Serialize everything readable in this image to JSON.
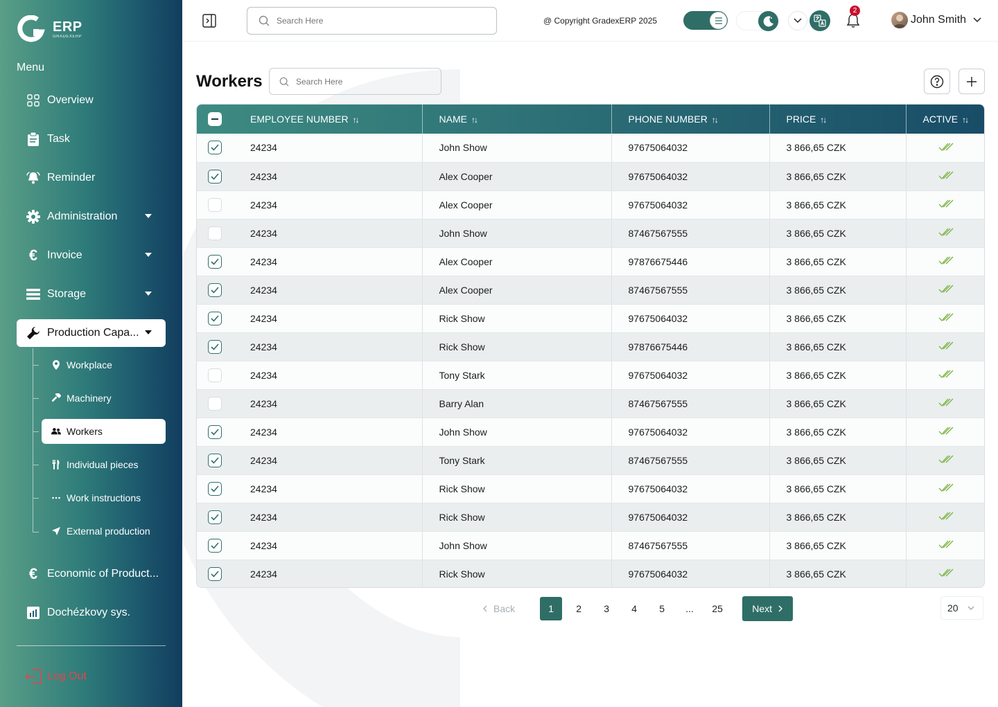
{
  "brand": {
    "name": "ERP",
    "sub": "GRADEXERP"
  },
  "sidebar": {
    "menu_title": "Menu",
    "items": [
      {
        "label": "Overview",
        "icon": "grid-icon"
      },
      {
        "label": "Task",
        "icon": "clipboard-icon"
      },
      {
        "label": "Reminder",
        "icon": "bell-ring-icon"
      },
      {
        "label": "Administration",
        "icon": "gear-icon"
      },
      {
        "label": "Invoice",
        "icon": "euro-icon"
      },
      {
        "label": "Storage",
        "icon": "list-icon"
      },
      {
        "label": "Production Capa...",
        "icon": "wrench-icon"
      },
      {
        "label": "Economic of Product...",
        "icon": "euro-icon"
      },
      {
        "label": "Dochézkovy sys.",
        "icon": "bar-chart-icon"
      }
    ],
    "sub_items": [
      {
        "label": "Workplace",
        "icon": "pin-icon"
      },
      {
        "label": "Machinery",
        "icon": "hammer-icon"
      },
      {
        "label": "Workers",
        "icon": "users-icon"
      },
      {
        "label": "Individual pieces",
        "icon": "tools-icon"
      },
      {
        "label": "Work instructions",
        "icon": "dots-icon"
      },
      {
        "label": "External production",
        "icon": "send-icon"
      }
    ],
    "logout": "Log Out"
  },
  "topbar": {
    "search_placeholder": "Search Here",
    "copyright": "@ Copyright GradexERP 2025",
    "notification_count": "2",
    "user_name": "John Smith"
  },
  "page": {
    "title": "Workers",
    "search_placeholder": "Search Here"
  },
  "table": {
    "columns": [
      "EMPLOYEE NUMBER",
      "NAME",
      "PHONE NUMBER",
      "PRICE",
      "ACTIVE"
    ],
    "rows": [
      {
        "checked": true,
        "emp": "24234",
        "name": "John Show",
        "phone": "97675064032",
        "price": "3 866,65 CZK"
      },
      {
        "checked": true,
        "emp": "24234",
        "name": "Alex Cooper",
        "phone": "97675064032",
        "price": "3 866,65 CZK"
      },
      {
        "checked": false,
        "emp": "24234",
        "name": "Alex Cooper",
        "phone": "97675064032",
        "price": "3 866,65 CZK"
      },
      {
        "checked": false,
        "emp": "24234",
        "name": "John Show",
        "phone": "87467567555",
        "price": "3 866,65 CZK"
      },
      {
        "checked": true,
        "emp": "24234",
        "name": "Alex Cooper",
        "phone": "97876675446",
        "price": "3 866,65 CZK"
      },
      {
        "checked": true,
        "emp": "24234",
        "name": "Alex Cooper",
        "phone": "87467567555",
        "price": "3 866,65 CZK"
      },
      {
        "checked": true,
        "emp": "24234",
        "name": "Rick Show",
        "phone": "97675064032",
        "price": "3 866,65 CZK"
      },
      {
        "checked": true,
        "emp": "24234",
        "name": "Rick Show",
        "phone": "97876675446",
        "price": "3 866,65 CZK"
      },
      {
        "checked": false,
        "emp": "24234",
        "name": "Tony Stark",
        "phone": "97675064032",
        "price": "3 866,65 CZK"
      },
      {
        "checked": false,
        "emp": "24234",
        "name": "Barry Alan",
        "phone": "87467567555",
        "price": "3 866,65 CZK"
      },
      {
        "checked": true,
        "emp": "24234",
        "name": "John Show",
        "phone": "97675064032",
        "price": "3 866,65 CZK"
      },
      {
        "checked": true,
        "emp": "24234",
        "name": "Tony Stark",
        "phone": "87467567555",
        "price": "3 866,65 CZK"
      },
      {
        "checked": true,
        "emp": "24234",
        "name": "Rick Show",
        "phone": "97675064032",
        "price": "3 866,65 CZK"
      },
      {
        "checked": true,
        "emp": "24234",
        "name": "Rick Show",
        "phone": "97675064032",
        "price": "3 866,65 CZK"
      },
      {
        "checked": true,
        "emp": "24234",
        "name": "John Show",
        "phone": "87467567555",
        "price": "3 866,65 CZK"
      },
      {
        "checked": true,
        "emp": "24234",
        "name": "Rick Show",
        "phone": "97675064032",
        "price": "3 866,65 CZK"
      }
    ]
  },
  "pagination": {
    "back": "Back",
    "pages": [
      "1",
      "2",
      "3",
      "4",
      "5",
      "...",
      "25"
    ],
    "current": "1",
    "next": "Next",
    "per_page": "20"
  },
  "colors": {
    "accent": "#2f6e66",
    "badge": "#c8102e",
    "logout": "#e0474c",
    "active_check": "#7cb342"
  }
}
